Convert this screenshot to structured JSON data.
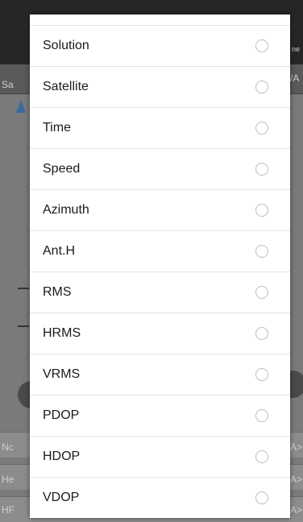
{
  "background": {
    "left_tab_fragment": "Sa",
    "right_tab_fragment": "/A",
    "right_icon_fragment": "ne",
    "row_fragments_left": [
      "Nc",
      "He",
      "HF"
    ],
    "row_fragments_right": [
      "A>",
      "A>",
      "A>"
    ]
  },
  "dialog": {
    "items": [
      {
        "label": "Solution",
        "selected": false
      },
      {
        "label": "Satellite",
        "selected": false
      },
      {
        "label": "Time",
        "selected": false
      },
      {
        "label": "Speed",
        "selected": false
      },
      {
        "label": "Azimuth",
        "selected": false
      },
      {
        "label": "Ant.H",
        "selected": false
      },
      {
        "label": "RMS",
        "selected": false
      },
      {
        "label": "HRMS",
        "selected": false
      },
      {
        "label": "VRMS",
        "selected": false
      },
      {
        "label": "PDOP",
        "selected": false
      },
      {
        "label": "HDOP",
        "selected": false
      },
      {
        "label": "VDOP",
        "selected": false
      }
    ]
  },
  "colors": {
    "dialog_bg": "#ffffff",
    "radio_border": "#bdbdbd",
    "text": "#1a1a1a",
    "overlay": "#7a7a7a"
  }
}
